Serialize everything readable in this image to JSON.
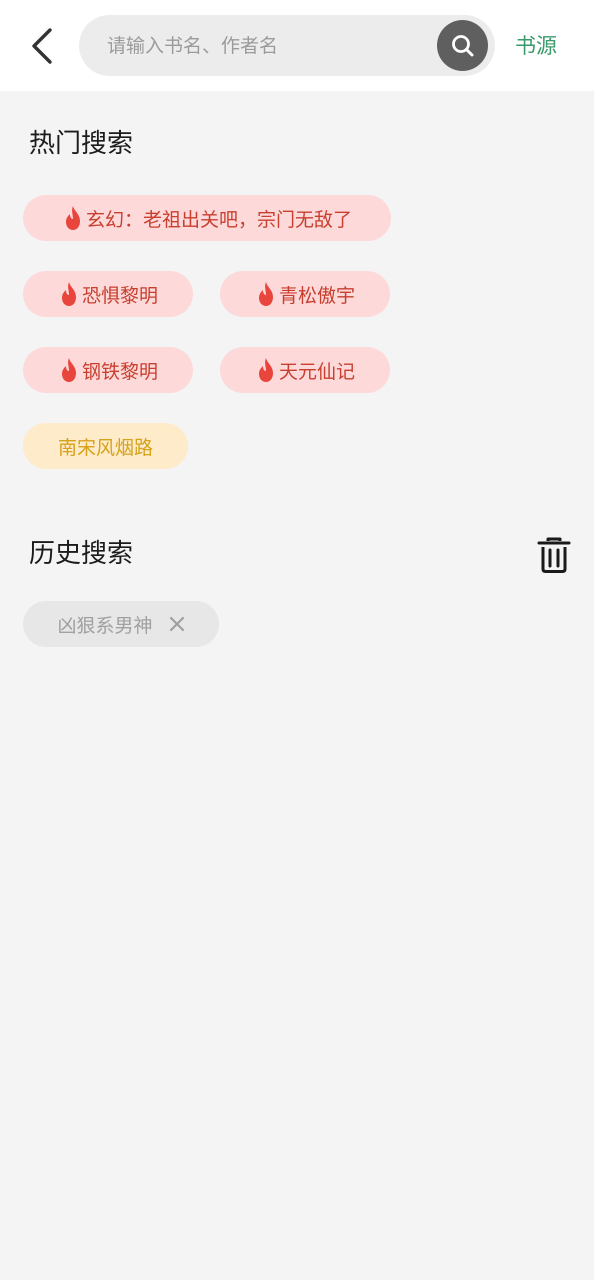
{
  "header": {
    "search_placeholder": "请输入书名、作者名",
    "source_label": "书源"
  },
  "hot": {
    "title": "热门搜索",
    "items": [
      {
        "label": "玄幻：老祖出关吧，宗门无敌了",
        "style": "hot"
      },
      {
        "label": "恐惧黎明",
        "style": "hot"
      },
      {
        "label": "青松傲宇",
        "style": "hot"
      },
      {
        "label": "钢铁黎明",
        "style": "hot"
      },
      {
        "label": "天元仙记",
        "style": "hot"
      },
      {
        "label": "南宋风烟路",
        "style": "warm"
      }
    ]
  },
  "history": {
    "title": "历史搜索",
    "items": [
      {
        "label": "凶狠系男神"
      }
    ]
  },
  "colors": {
    "accent_green": "#3a9a6c",
    "hot_chip_bg": "#fdd9d9",
    "hot_chip_text": "#c83f2f",
    "warm_chip_bg": "#fdebc9",
    "warm_chip_text": "#d7a11a",
    "history_chip_bg": "#e7e7e7",
    "history_chip_text": "#a0a0a0",
    "flame": "#e8453c"
  },
  "icons": [
    "back-arrow-icon",
    "search-icon",
    "fire-icon",
    "trash-icon",
    "close-icon"
  ]
}
